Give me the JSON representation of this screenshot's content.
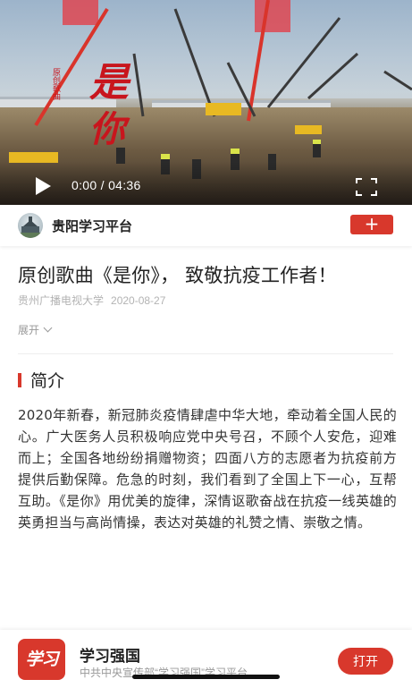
{
  "video": {
    "title_chars": [
      "是",
      "你"
    ],
    "overlay_tag": "原创歌曲",
    "current_time": "0:00",
    "duration": "04:36",
    "time_separator": "/",
    "play_icon": "play-icon",
    "fullscreen_icon": "fullscreen-icon"
  },
  "channel": {
    "name": "贵阳学习平台",
    "follow_label": "+"
  },
  "article": {
    "title": "原创歌曲《是你》， 致敬抗疫工作者！",
    "source": "贵州广播电视大学",
    "date": "2020-08-27",
    "expand_label": "展开"
  },
  "intro": {
    "heading": "简介",
    "body": "2020年新春，新冠肺炎疫情肆虐中华大地，牵动着全国人民的心。广大医务人员积极响应党中央号召，不顾个人安危，迎难而上；全国各地纷纷捐赠物资；四面八方的志愿者为抗疫前方提供后勤保障。危急的时刻，我们看到了全国上下一心，互帮互助。《是你》用优美的旋律，深情讴歌奋战在抗疫一线英雄的英勇担当与高尚情操，表达对英雄的礼赞之情、崇敬之情。"
  },
  "banner": {
    "logo_text": "学习",
    "app_name": "学习强国",
    "app_subtitle": "中共中央宣传部“学习强国”学习平台",
    "open_label": "打开"
  },
  "colors": {
    "accent": "#d8382c",
    "video_title": "#c8151d"
  }
}
